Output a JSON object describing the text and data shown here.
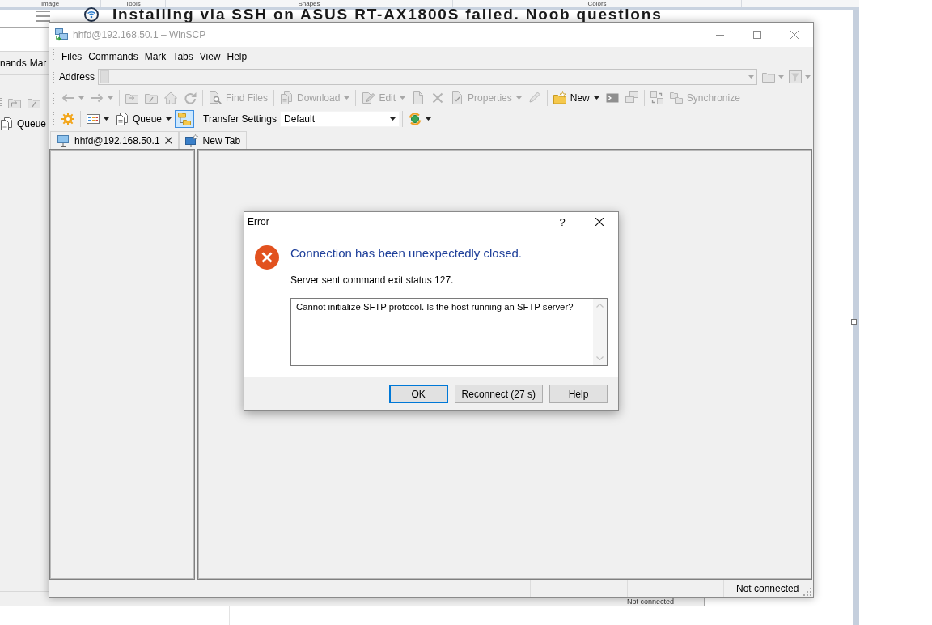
{
  "ribbon": {
    "groups": [
      "Image",
      "Tools",
      "Shapes",
      "Colors"
    ]
  },
  "web_page": {
    "heading": "Installing via SSH on ASUS RT-AX1800S failed. Noob questions"
  },
  "background_window": {
    "menu": [
      "nands",
      "Mar"
    ],
    "toolbar": [
      {
        "kind": "parent-folder",
        "disabled": true
      },
      {
        "kind": "root-folder",
        "disabled": true
      }
    ],
    "queue": {
      "kind": "queue",
      "label": "Queue",
      "disabled": false
    },
    "status": "Not connected"
  },
  "window": {
    "title": "hhfd@192.168.50.1 – WinSCP",
    "active": false,
    "menu": [
      "Files",
      "Commands",
      "Mark",
      "Tabs",
      "View",
      "Help"
    ],
    "address_bar": {
      "label": "Address",
      "disabled": true,
      "buttons": [
        {
          "kind": "folder",
          "disabled": true,
          "dropdown": true
        },
        {
          "kind": "filter",
          "disabled": true,
          "dropdown": true
        }
      ]
    },
    "toolbars": [
      {
        "groups": [
          [
            {
              "kind": "back",
              "disabled": true,
              "on": false,
              "dropdown": true
            },
            {
              "kind": "forward",
              "disabled": true,
              "on": false,
              "dropdown": true
            }
          ],
          [
            {
              "kind": "parent-folder",
              "disabled": true,
              "on": false
            },
            {
              "kind": "root-folder",
              "disabled": true,
              "on": false
            },
            {
              "kind": "home",
              "disabled": true,
              "on": false
            },
            {
              "kind": "refresh",
              "disabled": true,
              "on": false
            }
          ],
          [
            {
              "kind": "find-files",
              "label": "Find Files",
              "disabled": true,
              "on": false
            }
          ],
          [
            {
              "kind": "download",
              "label": "Download",
              "disabled": true,
              "on": false,
              "dropdown": true
            }
          ],
          [
            {
              "kind": "edit",
              "label": "Edit",
              "disabled": true,
              "on": false,
              "dropdown": true
            },
            {
              "kind": "duplicate",
              "disabled": true,
              "on": false
            },
            {
              "kind": "delete",
              "disabled": true,
              "on": false
            },
            {
              "kind": "properties",
              "label": "Properties",
              "disabled": true,
              "on": false,
              "dropdown": true
            },
            {
              "kind": "rename",
              "disabled": true,
              "on": false
            }
          ],
          [
            {
              "kind": "new",
              "label": "New",
              "disabled": false,
              "on": false,
              "dropdown": true
            },
            {
              "kind": "console",
              "disabled": true,
              "on": false
            },
            {
              "kind": "sessions",
              "disabled": true,
              "on": false
            }
          ],
          [
            {
              "kind": "sync-browse",
              "disabled": true,
              "on": false
            },
            {
              "kind": "synchronize",
              "label": "Synchronize",
              "disabled": true,
              "on": false
            }
          ]
        ]
      },
      {
        "groups": [
          [
            {
              "kind": "preferences",
              "disabled": false,
              "on": false
            }
          ],
          [
            {
              "kind": "view",
              "disabled": false,
              "on": false,
              "dropdown": true
            },
            {
              "kind": "queue",
              "label": "Queue",
              "disabled": false,
              "on": false,
              "dropdown": true
            },
            {
              "kind": "tree",
              "disabled": false,
              "on": true
            }
          ],
          [
            {
              "kind": "label",
              "label": "Transfer Settings",
              "disabled": false,
              "on": false
            },
            {
              "kind": "combo",
              "value": "Default",
              "disabled": false,
              "on": false
            }
          ],
          [
            {
              "kind": "sync",
              "disabled": false,
              "on": false,
              "dropdown": true
            }
          ]
        ]
      }
    ],
    "tabs": [
      {
        "kind": "session",
        "label": "hhfd@192.168.50.1",
        "closable": true
      },
      {
        "kind": "new",
        "label": "New Tab",
        "closable": false
      }
    ],
    "status_bar": {
      "text": "Not connected"
    }
  },
  "dialog": {
    "title": "Error",
    "help_button": "?",
    "heading": "Connection has been unexpectedly closed.",
    "message": "Server sent command exit status 127.",
    "details": "Cannot initialize SFTP protocol. Is the host running an SFTP server?",
    "buttons": [
      {
        "label": "OK",
        "default": true
      },
      {
        "label": "Reconnect (27 s)",
        "default": false
      },
      {
        "label": "Help",
        "default": false
      }
    ]
  }
}
